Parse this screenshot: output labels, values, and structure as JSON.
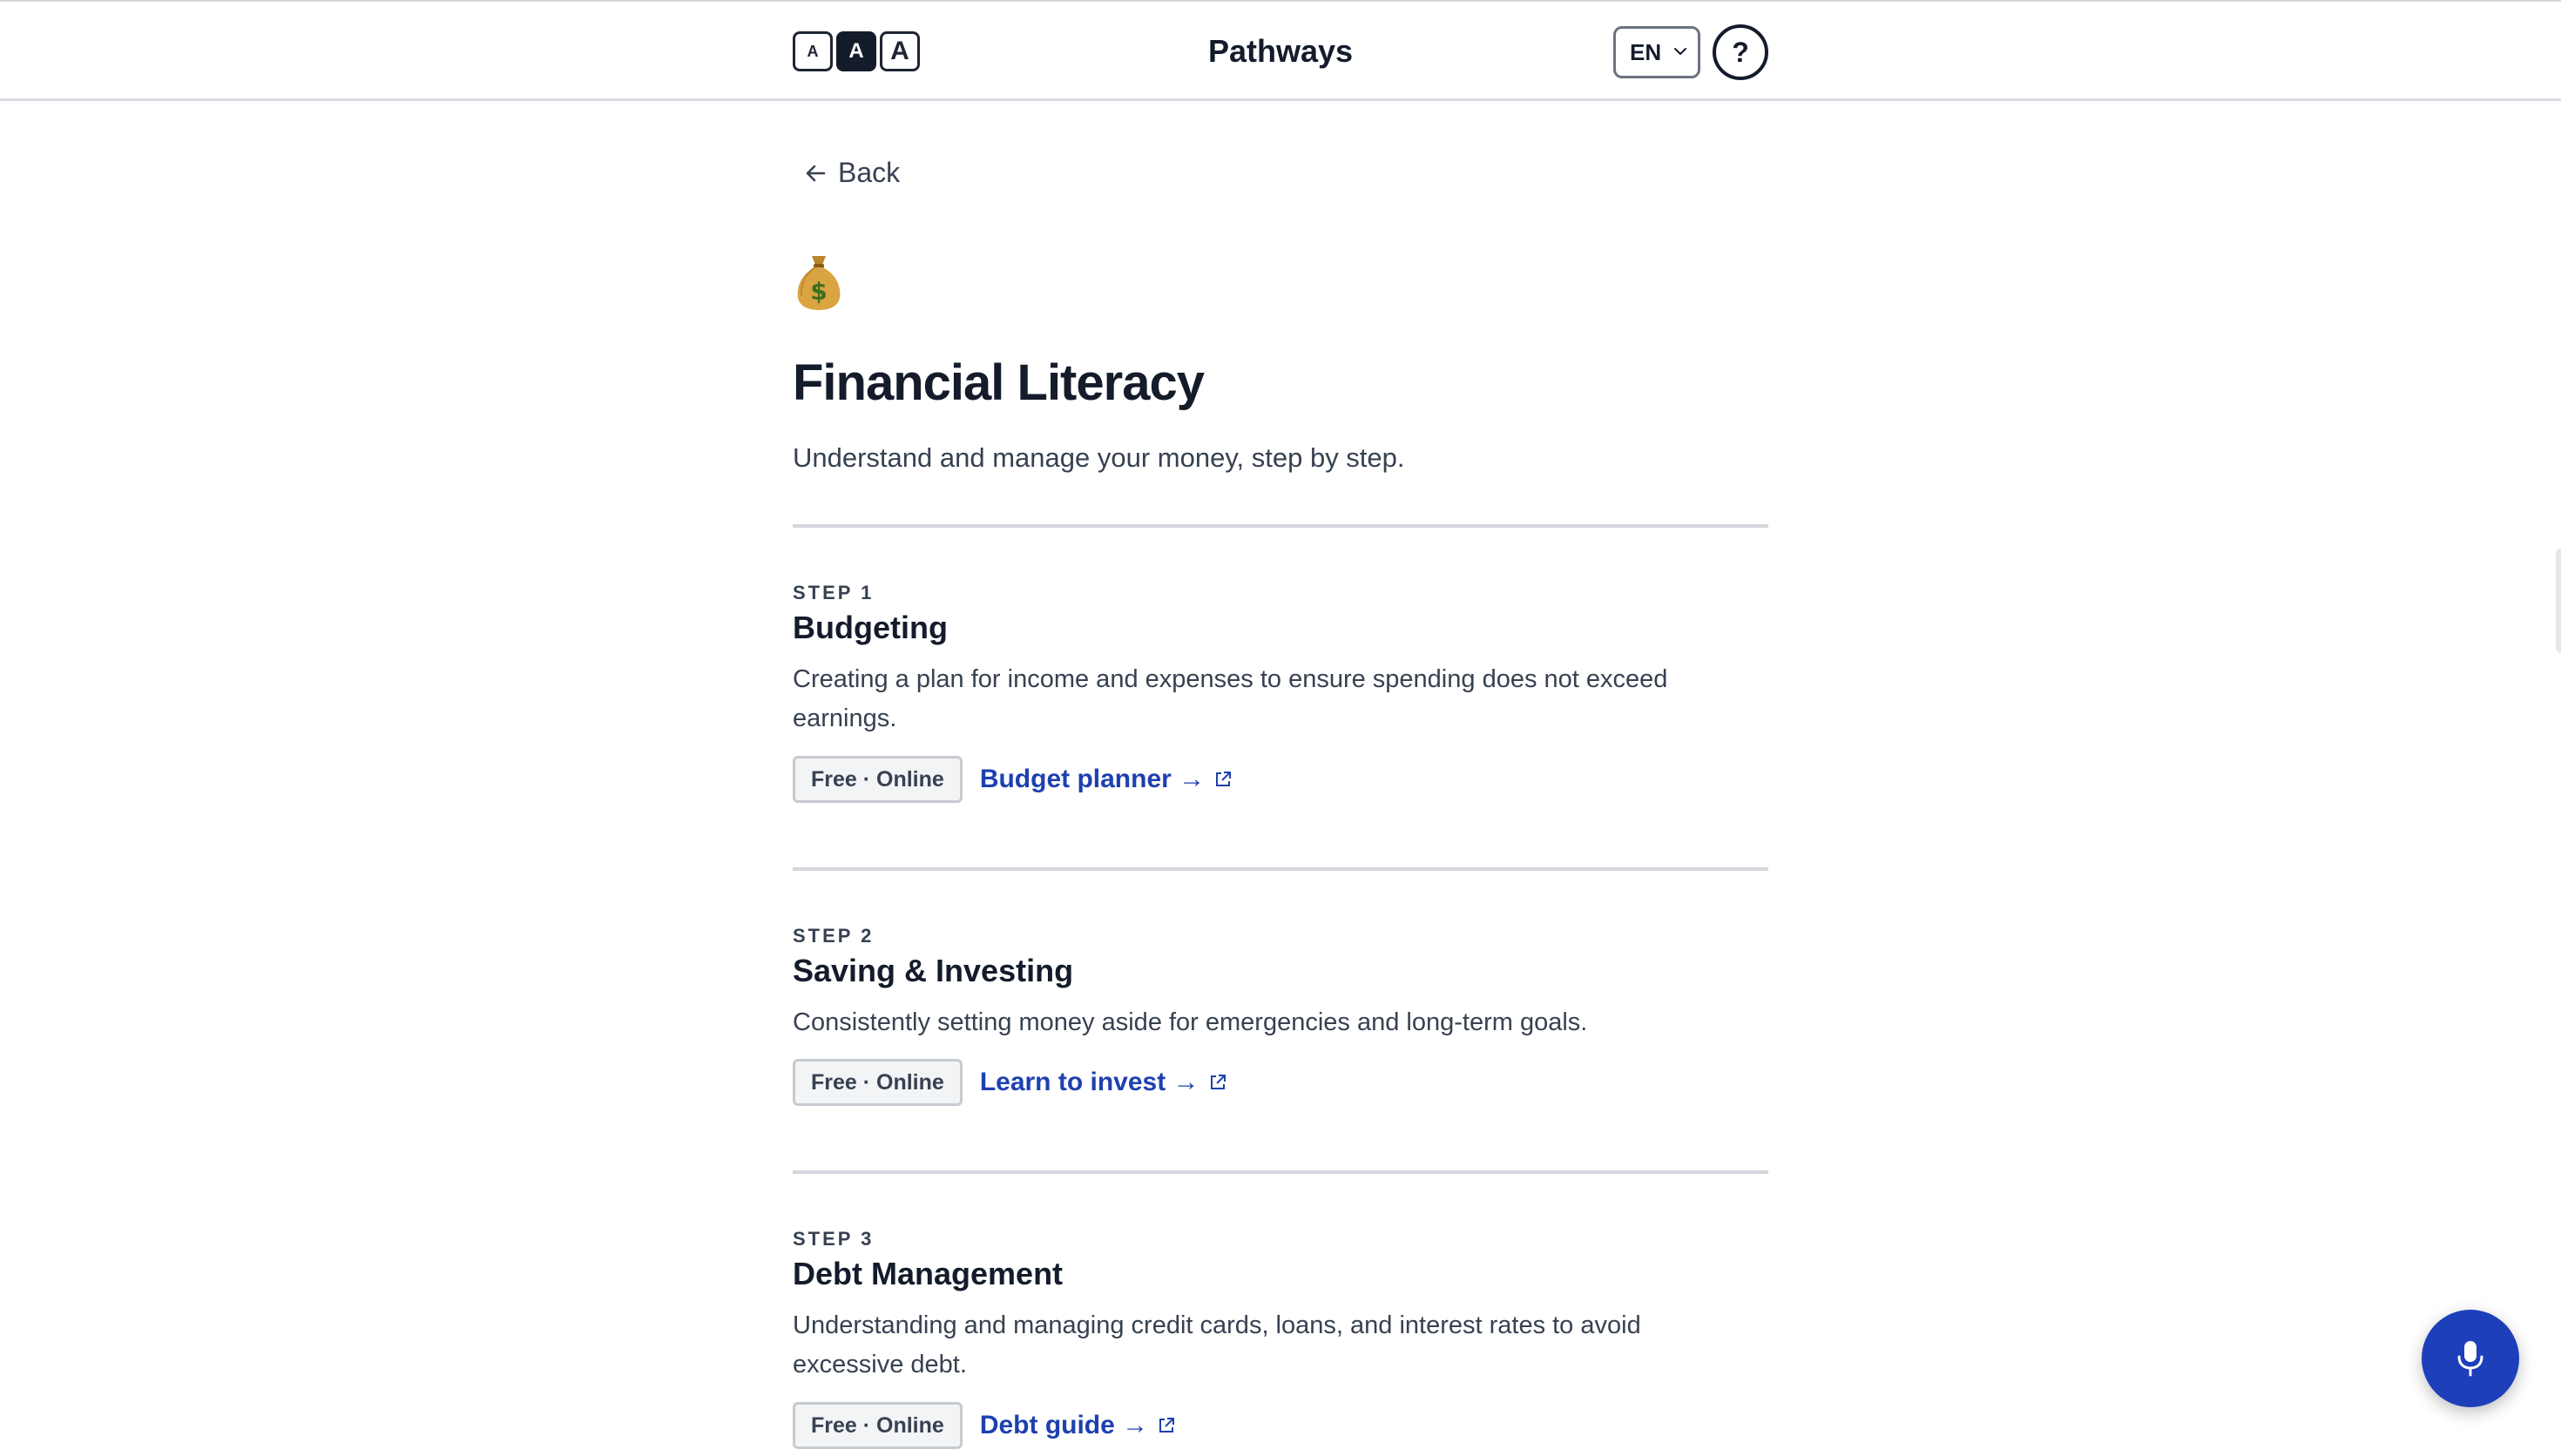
{
  "header": {
    "font_size_buttons": [
      {
        "label": "A",
        "size": "small"
      },
      {
        "label": "A",
        "size": "medium",
        "selected": true
      },
      {
        "label": "A",
        "size": "large"
      }
    ],
    "app_title": "Pathways",
    "language": "EN",
    "help_label": "?"
  },
  "nav": {
    "back_label": "Back"
  },
  "page": {
    "icon": "money-bag-icon",
    "title": "Financial Literacy",
    "subtitle": "Understand and manage your money, step by step."
  },
  "steps": [
    {
      "label": "STEP 1",
      "title": "Budgeting",
      "description": "Creating a plan for income and expenses to ensure spending does not exceed earnings.",
      "badge": "Free · Online",
      "link": "Budget planner →"
    },
    {
      "label": "STEP 2",
      "title": "Saving & Investing",
      "description": "Consistently setting money aside for emergencies and long-term goals.",
      "badge": "Free · Online",
      "link": "Learn to invest →"
    },
    {
      "label": "STEP 3",
      "title": "Debt Management",
      "description": "Understanding and managing credit cards, loans, and interest rates to avoid excessive debt.",
      "badge": "Free · Online",
      "link": "Debt guide →"
    }
  ],
  "colors": {
    "link": "#1e40af",
    "mic_button": "#1e3fba",
    "text_dark": "#141b2b",
    "divider": "#d4d7dd"
  },
  "fab": {
    "icon": "microphone-icon"
  }
}
